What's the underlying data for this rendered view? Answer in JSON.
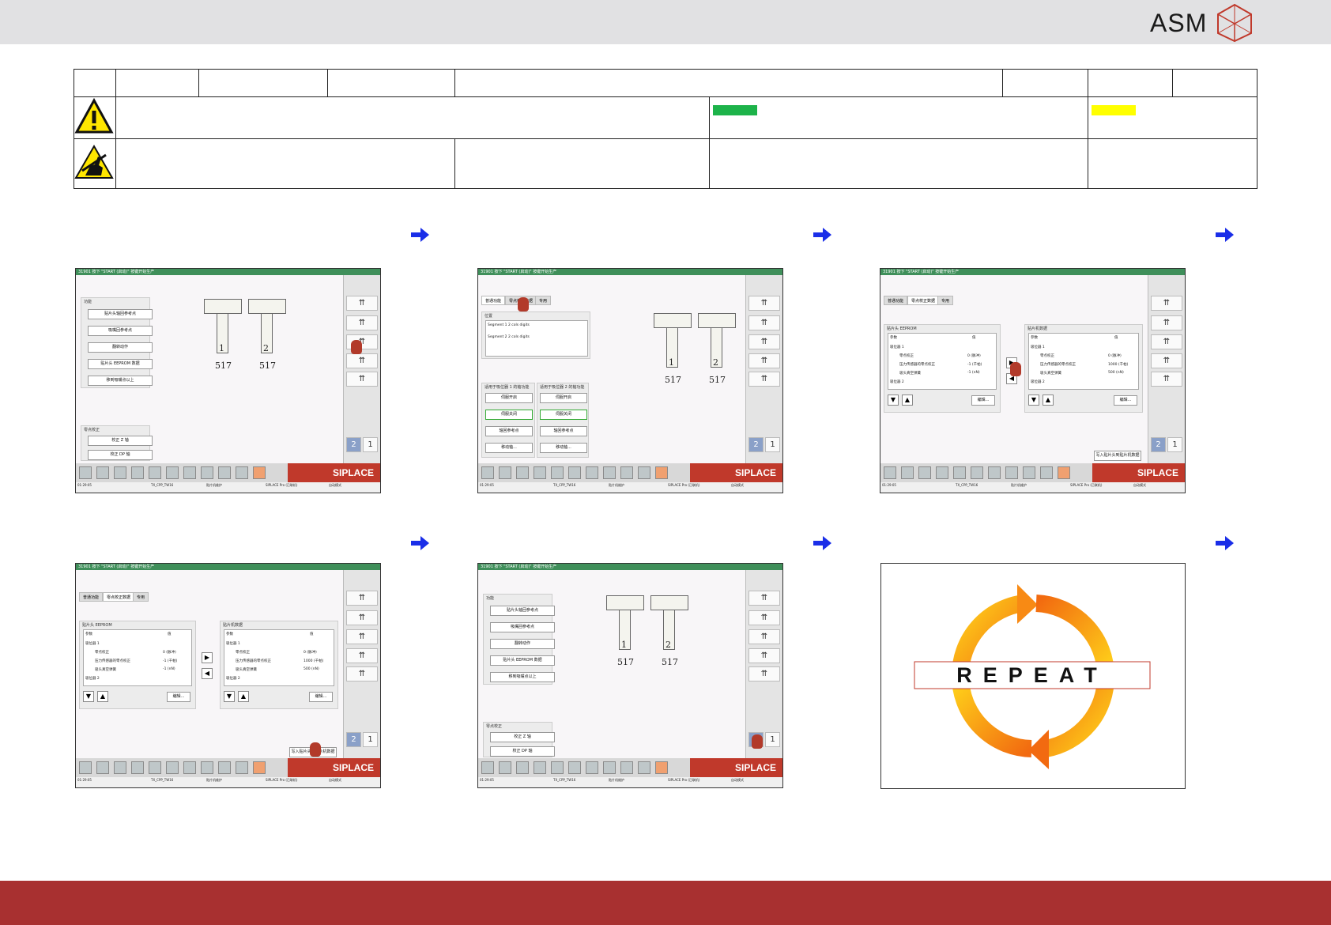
{
  "header": {
    "logo_text": "ASM"
  },
  "colors": {
    "accent_green": "#1db34a",
    "accent_yellow": "#ffff00",
    "brand_red": "#a83030",
    "siplace_red": "#c0392b",
    "arrow_blue": "#1a2ee8"
  },
  "screens": {
    "titlebar": "31901  按下 \"START (启动)\" 按键开始生产",
    "siplace_label": "SIPLACE",
    "status": {
      "time": "01:29:05",
      "station": "TX_CPP_TW16",
      "mode": "贴片机维护",
      "pro": "SIPLACE Pro (已联机)",
      "auto": "自动模式"
    },
    "func_title": "功能",
    "func_buttons": [
      "贴片头轴回参考点",
      "吸嘴回参考点",
      "翻转动作",
      "贴片头 EEPROM 数据",
      "移到吸嘴点以上"
    ],
    "zero_title": "零点校正",
    "zero_buttons": [
      "校正 Z 轴",
      "校正 DP 轴"
    ],
    "nozzle_labels": [
      "1",
      "2"
    ],
    "nozzle_value_1": "517",
    "nozzle_value_2": "517",
    "tabs": [
      "普通功能",
      "零点校正数据",
      "专用"
    ],
    "pos_title": "位置",
    "pos_lines": [
      "Segment 1 2 cols digits",
      "Segment 2 2 cols digits"
    ],
    "valve_title_1": "适用于吸位器 1 的轴功能",
    "valve_title_2": "适用于吸位器 2 的轴功能",
    "valve_open": "伺服开启",
    "valve_close": "伺服关闭",
    "valve_ref": "轴回参考点",
    "valve_move": "移动轴...",
    "eeprom_title": "贴片头 EEPROM",
    "machine_title": "贴片机数据",
    "col_param": "参数",
    "col_value": "值",
    "rows": [
      "吸位器 1",
      "零点校正",
      "压力传感器的零点校正",
      "吸头真空弹簧",
      "吸位器 2"
    ],
    "values_left": [
      "0 (脉冲)",
      "-1 (千帕)",
      "-1 (nN)"
    ],
    "values_right": [
      "0 (脉冲)",
      "1000 (千帕)",
      "500 (nN)"
    ],
    "edit_label": "编辑...",
    "write_label": "写入贴片头到贴片机数据",
    "right_btn_2": "2",
    "right_btn_1": "1"
  },
  "repeat": {
    "word": "REPEAT"
  }
}
